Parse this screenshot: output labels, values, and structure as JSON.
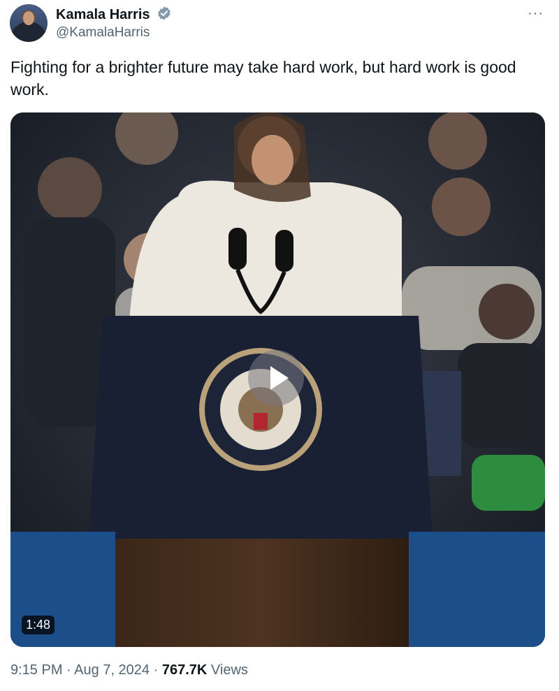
{
  "tweet": {
    "author_name": "Kamala Harris",
    "handle": "@KamalaHarris",
    "more_label": "···",
    "text": "Fighting for a brighter future may take hard work, but hard work is good work.",
    "video": {
      "duration": "1:48"
    },
    "meta": {
      "time": "9:15 PM",
      "separator": "·",
      "date": "Aug 7, 2024",
      "views_count": "767.7K",
      "views_label": "Views"
    }
  },
  "colors": {
    "verified_badge": "#829aab",
    "text_primary": "#0f1419",
    "text_secondary": "#536471"
  }
}
